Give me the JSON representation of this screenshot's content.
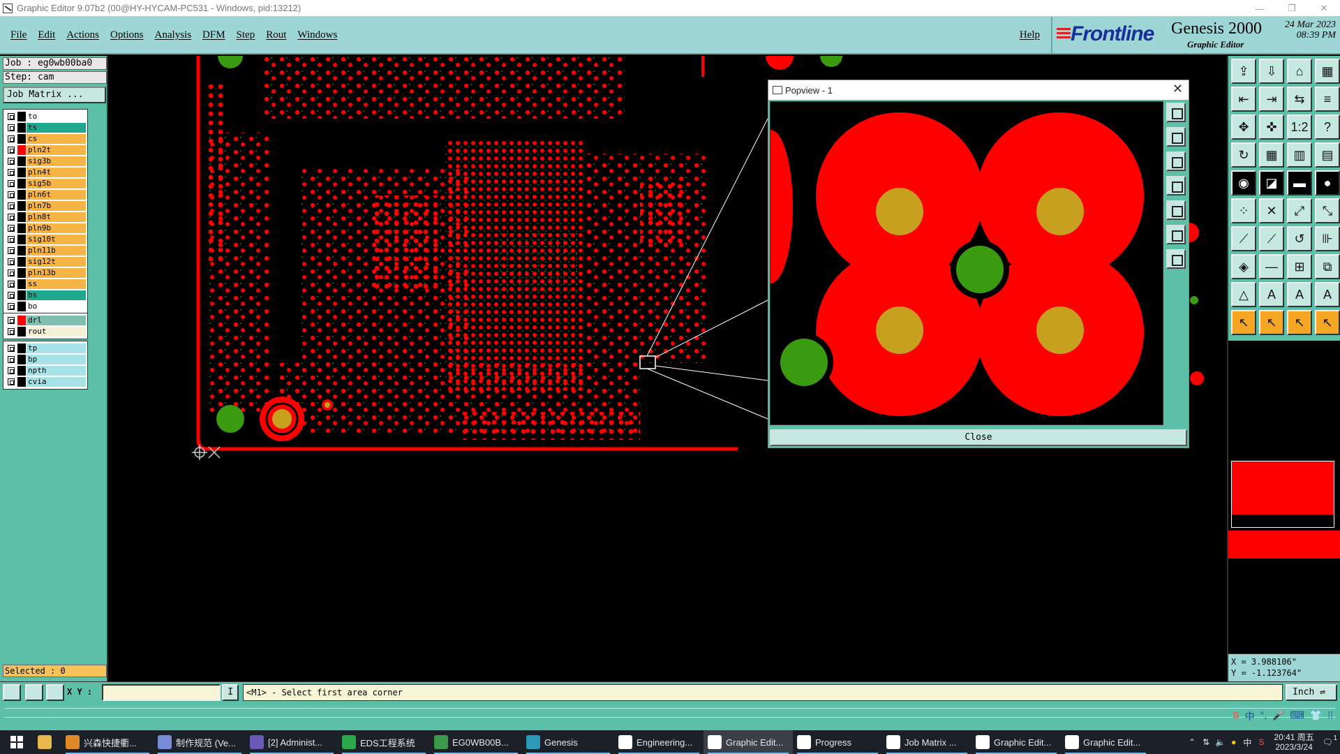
{
  "window": {
    "title": "Graphic Editor 9.07b2 (00@HY-HYCAM-PC531 - Windows, pid:13212)"
  },
  "menu": {
    "items": [
      "File",
      "Edit",
      "Actions",
      "Options",
      "Analysis",
      "DFM",
      "Step",
      "Rout",
      "Windows"
    ],
    "help": "Help"
  },
  "branding": {
    "logo": "Frontline",
    "product": "Genesis 2000",
    "subtitle": "Graphic Editor",
    "date": "24 Mar 2023",
    "time": "08:39 PM"
  },
  "job": {
    "job_label": "Job : eg0wb00ba0",
    "step_label": "Step: cam",
    "matrix_button": "Job Matrix ..."
  },
  "layers": {
    "group1": [
      {
        "name": "to",
        "color": "#ffffff",
        "active": false
      },
      {
        "name": "ts",
        "color": "#1fa88e",
        "active": false
      },
      {
        "name": "cs",
        "color": "#f5b445",
        "active": false
      },
      {
        "name": "pln2t",
        "color": "#f5b445",
        "active": true
      },
      {
        "name": "sig3b",
        "color": "#f5b445",
        "active": false
      },
      {
        "name": "pln4t",
        "color": "#f5b445",
        "active": false
      },
      {
        "name": "sig5b",
        "color": "#f5b445",
        "active": false
      },
      {
        "name": "pln6t",
        "color": "#f5b445",
        "active": false
      },
      {
        "name": "pln7b",
        "color": "#f5b445",
        "active": false
      },
      {
        "name": "pln8t",
        "color": "#f5b445",
        "active": false
      },
      {
        "name": "pln9b",
        "color": "#f5b445",
        "active": false
      },
      {
        "name": "sig10t",
        "color": "#f5b445",
        "active": false
      },
      {
        "name": "pln11b",
        "color": "#f5b445",
        "active": false
      },
      {
        "name": "sig12t",
        "color": "#f5b445",
        "active": false
      },
      {
        "name": "pln13b",
        "color": "#f5b445",
        "active": false
      },
      {
        "name": "ss",
        "color": "#f5b445",
        "active": false
      },
      {
        "name": "bs",
        "color": "#1fa88e",
        "active": false
      },
      {
        "name": "bo",
        "color": "#ffffff",
        "active": false
      }
    ],
    "group2": [
      {
        "name": "drl",
        "color": "#7fbfb0",
        "active": true
      },
      {
        "name": "rout",
        "color": "#f5f0d8",
        "active": false
      }
    ],
    "group3": [
      {
        "name": "tp",
        "color": "#a9e3ea",
        "active": false
      },
      {
        "name": "bp",
        "color": "#a9e3ea",
        "active": false
      },
      {
        "name": "npth",
        "color": "#a9e3ea",
        "active": false
      },
      {
        "name": "cvia",
        "color": "#a9e3ea",
        "active": false
      }
    ]
  },
  "selected": "Selected : 0",
  "popview": {
    "title": "Popview - 1",
    "close_label": "Close"
  },
  "coords": {
    "x": "X = 3.988106\"",
    "y": "Y = -1.123764\""
  },
  "status": {
    "xy_label": "X Y :",
    "xy_value": "",
    "cursor_glyph": "I",
    "message": "<M1> - Select first area corner",
    "unit": "Inch"
  },
  "taskbar": {
    "items": [
      {
        "label": "兴森快捷衢...",
        "icon": "#e08a2a",
        "active": false
      },
      {
        "label": "制作规范 (Ve...",
        "icon": "#7a8bd8",
        "active": false
      },
      {
        "label": "[2] Administ...",
        "icon": "#6b5bb8",
        "active": false
      },
      {
        "label": "EDS工程系统",
        "icon": "#2aa84a",
        "active": false
      },
      {
        "label": "EG0WB00B...",
        "icon": "#3a9a4a",
        "active": false
      },
      {
        "label": "Genesis",
        "icon": "#2a9ab8",
        "active": false
      },
      {
        "label": "Engineering...",
        "icon": "#ffffff",
        "active": false
      },
      {
        "label": "Graphic Edit...",
        "icon": "#ffffff",
        "active": true
      },
      {
        "label": "Progress",
        "icon": "#ffffff",
        "active": false
      },
      {
        "label": "Job Matrix ...",
        "icon": "#ffffff",
        "active": false
      },
      {
        "label": "Graphic Edit...",
        "icon": "#ffffff",
        "active": false
      },
      {
        "label": "Graphic Edit...",
        "icon": "#ffffff",
        "active": false
      }
    ],
    "tray_time": "20:41 周五",
    "tray_date": "2023/3/24",
    "tray_lang": "中",
    "notification_count": "1"
  },
  "colors": {
    "panel": "#5cbfa8",
    "menu": "#9ed5d5",
    "copper": "#ff0000",
    "drill": "#c8a020",
    "via": "#3a9a10"
  }
}
